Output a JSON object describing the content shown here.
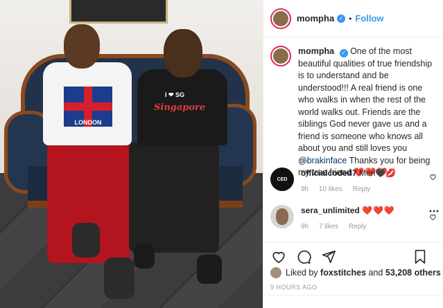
{
  "post": {
    "username": "mompha",
    "follow_label": "Follow",
    "separator": "•",
    "verified_glyph": "✓"
  },
  "caption": {
    "username": "mompha",
    "text_before_mention": "One of the most beautiful qualities of true friendship is to understand and be understood!!! A real friend is one who walks in when the rest of the world walks out. Friends are the siblings God never gave us and a friend is someone who knows all about you and still loves you",
    "mention": "@brakinface",
    "text_after_mention": "Thanks you for being my true friend",
    "emoji": "❤️❤️❤️",
    "time": "9h"
  },
  "comments": [
    {
      "username": "officialcoded7",
      "text": "Men🖤💋",
      "time": "9h",
      "likes": "10 likes",
      "reply": "Reply",
      "avatar_text": "CED"
    },
    {
      "username": "sera_unlimited",
      "text": "❤️❤️❤️",
      "time": "9h",
      "likes": "7 likes",
      "reply": "Reply",
      "avatar_text": ""
    }
  ],
  "likes": {
    "prefix": "Liked by",
    "first_liker": "foxstitches",
    "connector": "and",
    "others": "53,208 others"
  },
  "posted_ago": "9 HOURS AGO",
  "photo": {
    "shirt_text": "Singapore",
    "shirt_small": "I ❤ SG",
    "london_text": "LONDON"
  },
  "icons": [
    "heart-icon",
    "comment-icon",
    "share-icon",
    "save-icon",
    "verified-badge-icon",
    "more-icon"
  ],
  "colors": {
    "link": "#3897f0",
    "heart": "#ed4956",
    "verified": "#3897f0"
  }
}
